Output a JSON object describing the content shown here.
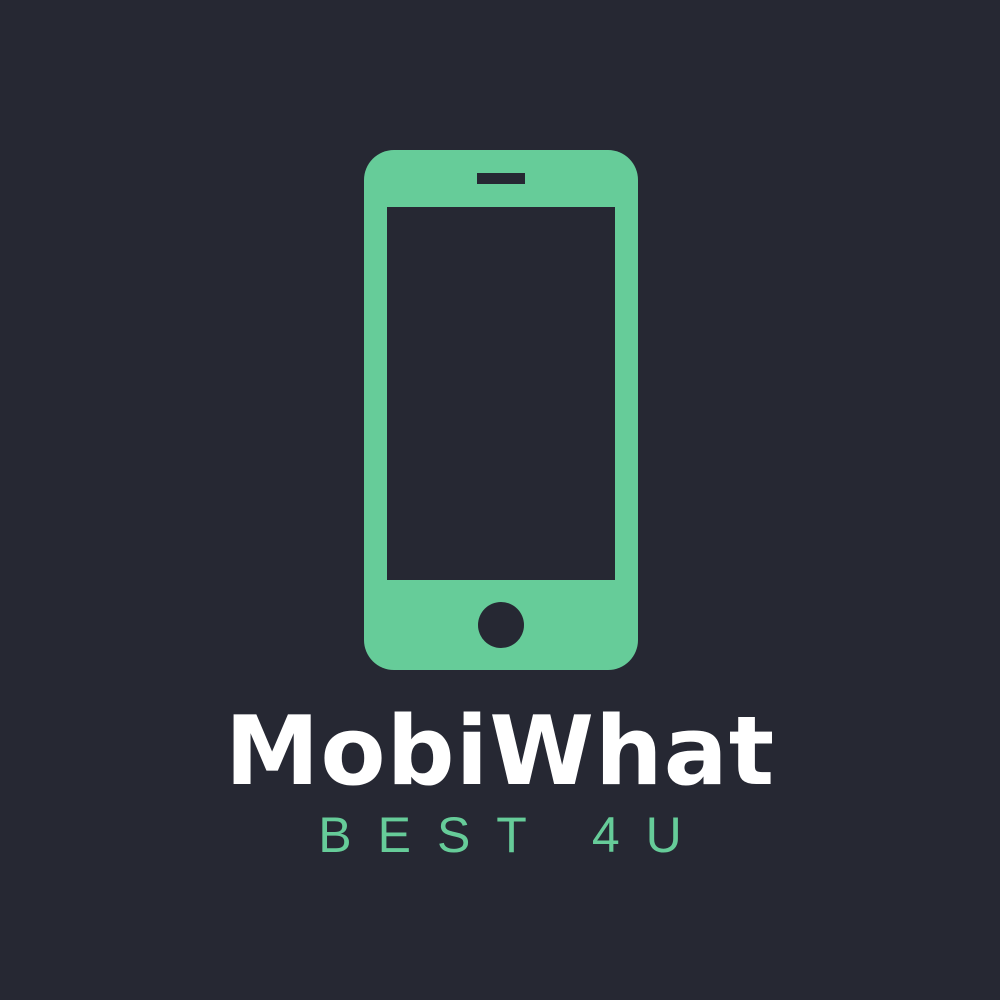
{
  "logo": {
    "icon": "smartphone-icon",
    "brand_name": "MobiWhat",
    "tagline": "BEST 4U"
  },
  "colors": {
    "background": "#262833",
    "accent": "#66cc99",
    "brand_name": "#ffffff"
  }
}
